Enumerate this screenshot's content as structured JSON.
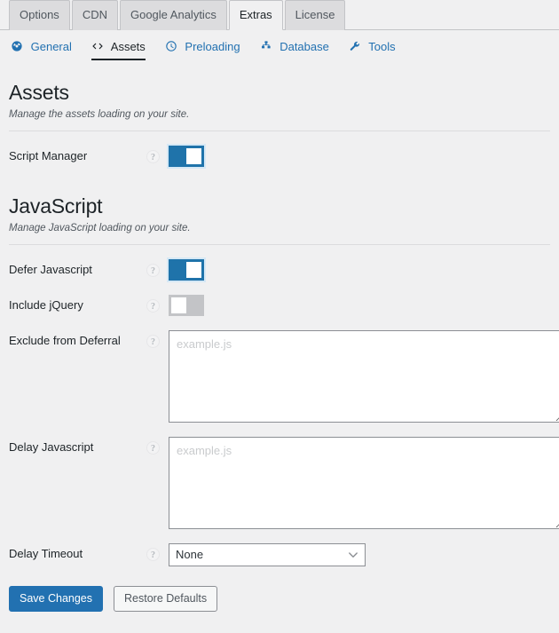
{
  "tabs": [
    {
      "label": "Options",
      "active": false
    },
    {
      "label": "CDN",
      "active": false
    },
    {
      "label": "Google Analytics",
      "active": false
    },
    {
      "label": "Extras",
      "active": true
    },
    {
      "label": "License",
      "active": false
    }
  ],
  "subnav": [
    {
      "label": "General",
      "icon": "dashboard-icon",
      "active": false
    },
    {
      "label": "Assets",
      "icon": "code-brackets-icon",
      "active": true
    },
    {
      "label": "Preloading",
      "icon": "clock-icon",
      "active": false
    },
    {
      "label": "Database",
      "icon": "sitemap-icon",
      "active": false
    },
    {
      "label": "Tools",
      "icon": "wrench-icon",
      "active": false
    }
  ],
  "sections": [
    {
      "title": "Assets",
      "subtitle": "Manage the assets loading on your site.",
      "fields": [
        {
          "label": "Script Manager",
          "type": "toggle",
          "value": "on",
          "help": "?"
        }
      ]
    },
    {
      "title": "JavaScript",
      "subtitle": "Manage JavaScript loading on your site.",
      "fields": [
        {
          "label": "Defer Javascript",
          "type": "toggle",
          "value": "on",
          "help": "?"
        },
        {
          "label": "Include jQuery",
          "type": "toggle",
          "value": "off",
          "help": "?"
        },
        {
          "label": "Exclude from Deferral",
          "type": "textarea",
          "value": "",
          "placeholder": "example.js",
          "help": "?"
        },
        {
          "label": "Delay Javascript",
          "type": "textarea",
          "value": "",
          "placeholder": "example.js",
          "help": "?"
        },
        {
          "label": "Delay Timeout",
          "type": "select",
          "value": "None",
          "options": [
            "None"
          ],
          "help": "?"
        }
      ]
    }
  ],
  "footer": {
    "save_label": "Save Changes",
    "restore_label": "Restore Defaults"
  },
  "colors": {
    "accent": "#2271b1",
    "toggle_on": "#1f73aa",
    "toggle_off": "#c3c4c7",
    "page_bg": "#f0f0f1",
    "text": "#1d2327"
  }
}
